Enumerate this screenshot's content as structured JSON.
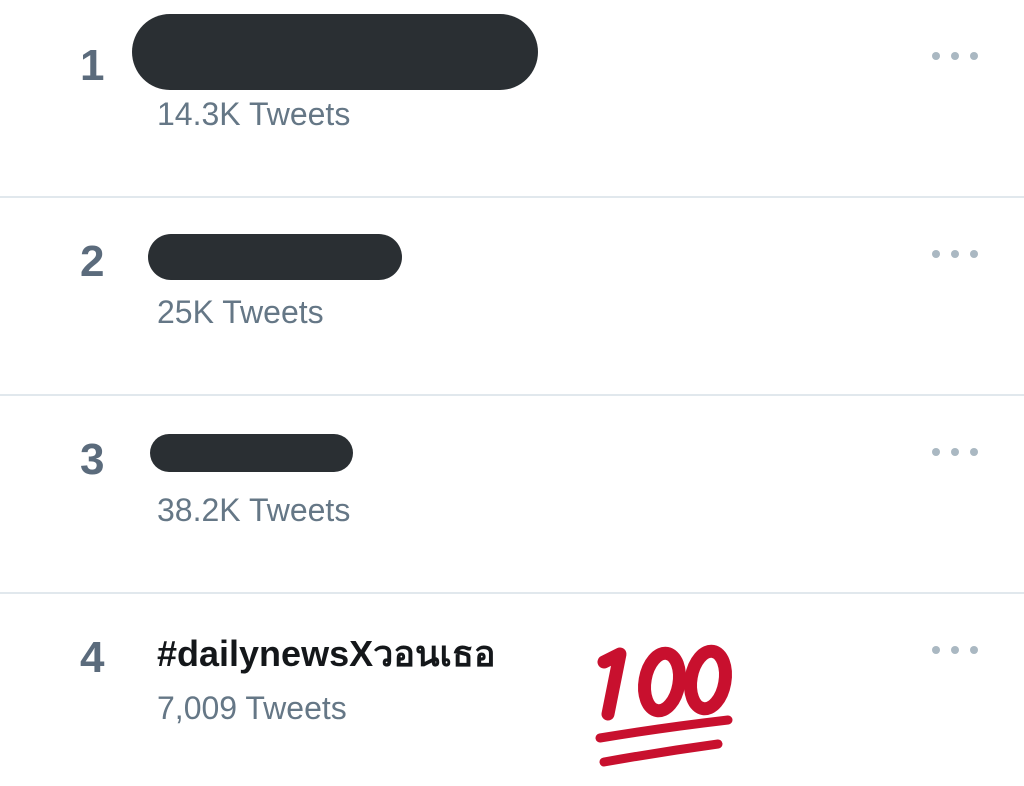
{
  "trends": [
    {
      "rank": "1",
      "name": "",
      "tweet_count": "14.3K Tweets",
      "redacted": true
    },
    {
      "rank": "2",
      "name": "",
      "tweet_count": "25K Tweets",
      "redacted": true
    },
    {
      "rank": "3",
      "name": "",
      "tweet_count": "38.2K Tweets",
      "redacted": true
    },
    {
      "rank": "4",
      "name": "#dailynewsXวอนเธอ",
      "tweet_count": "7,009 Tweets",
      "redacted": false
    }
  ],
  "decoration": {
    "emoji_icon": "hundred-points-icon",
    "emoji_color": "#c8102e"
  },
  "colors": {
    "rank": "#5b6b7c",
    "count": "#657786",
    "name": "#14171a",
    "redaction": "#2a2f33",
    "divider": "#e1e8ed",
    "more_dots": "#aab8c2"
  }
}
